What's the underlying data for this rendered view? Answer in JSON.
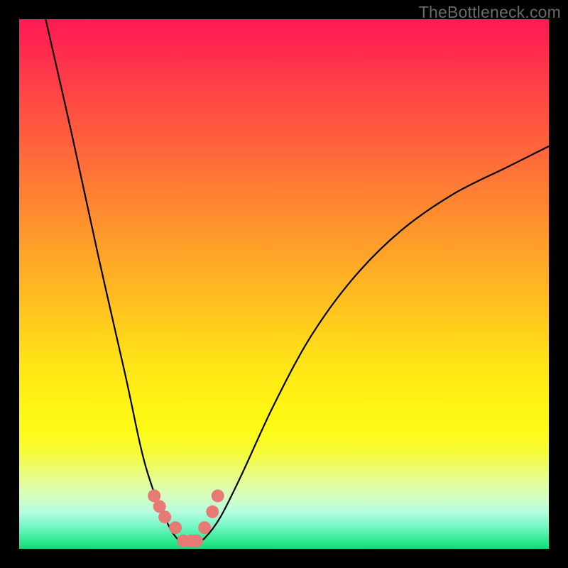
{
  "watermark": "TheBottleneck.com",
  "colors": {
    "marker": "#e77a75",
    "curve": "#000000"
  },
  "chart_data": {
    "type": "line",
    "title": "",
    "xlabel": "",
    "ylabel": "",
    "xlim": [
      0,
      100
    ],
    "ylim": [
      0,
      100
    ],
    "series": [
      {
        "name": "bottleneck-curve",
        "x": [
          5,
          10,
          15,
          20,
          23,
          25,
          27,
          29,
          31,
          33,
          35,
          38,
          42,
          48,
          55,
          63,
          72,
          82,
          92,
          100
        ],
        "y": [
          100,
          78,
          55,
          33,
          19,
          12,
          7,
          3,
          1,
          1,
          2,
          6,
          14,
          27,
          40,
          51,
          60,
          67,
          72,
          76
        ]
      }
    ],
    "markers": {
      "name": "highlight-dip",
      "x": [
        25.5,
        26.5,
        27.5,
        29.5,
        31.0,
        32.5,
        33.5,
        35.0,
        36.5,
        37.5
      ],
      "y": [
        10,
        8,
        6,
        4,
        1.5,
        1.5,
        1.5,
        4,
        7,
        10
      ]
    }
  }
}
